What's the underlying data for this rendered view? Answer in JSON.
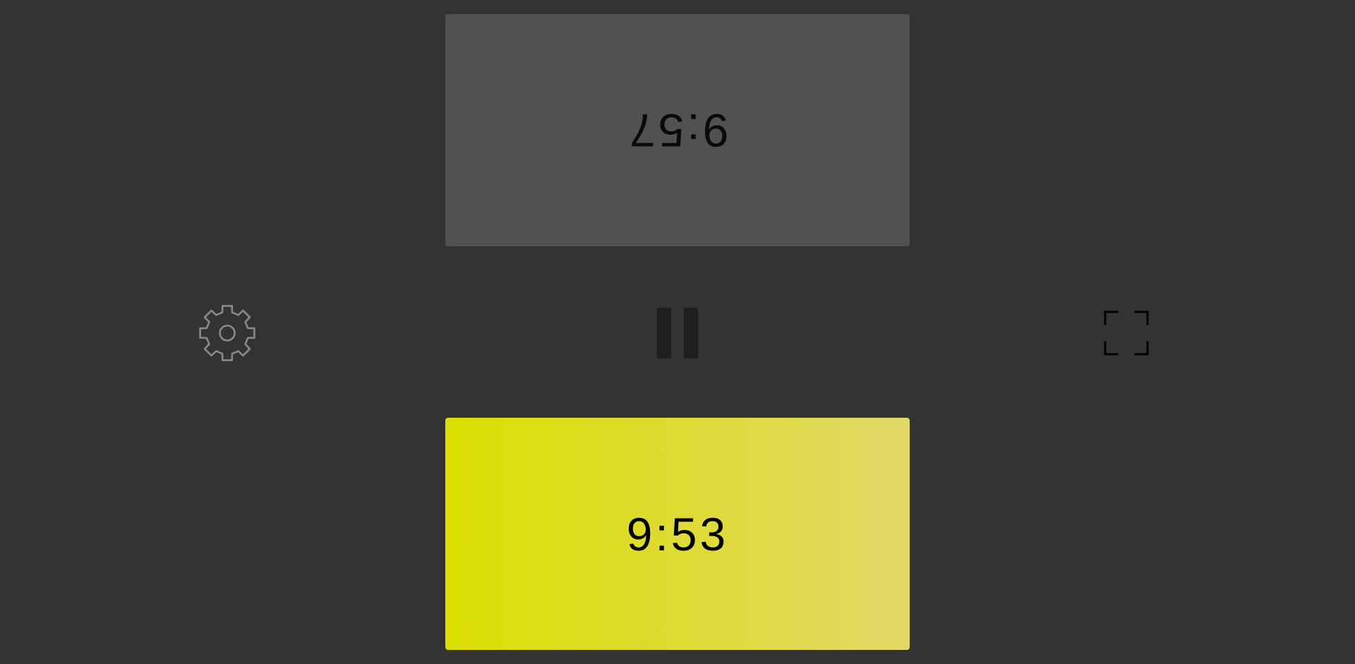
{
  "clocks": {
    "top": {
      "time": "9:57",
      "color": "#515151",
      "inverted": true
    },
    "bottom": {
      "time": "9:53",
      "color": "#dcdf00",
      "active": true
    }
  },
  "controls": {
    "settings": {
      "icon": "gear-icon",
      "color": "#8a8a8a"
    },
    "pause": {
      "icon": "pause-icon",
      "color": "#1e1e1e"
    },
    "fullscreen": {
      "icon": "fullscreen-icon",
      "color": "#000000"
    }
  },
  "theme": {
    "background": "#333333",
    "active_gradient_start": "#dcdf00",
    "active_gradient_end": "#e2d96a"
  }
}
